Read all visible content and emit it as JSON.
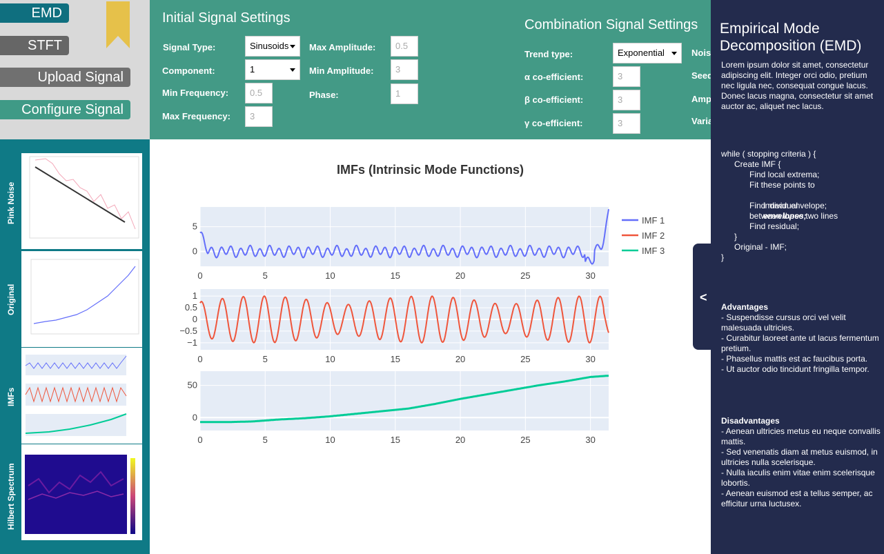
{
  "nav": {
    "emd": "EMD",
    "stft": "STFT",
    "upload": "Upload Signal",
    "configure": "Configure Signal"
  },
  "initial": {
    "title": "Initial Signal Settings",
    "signal_type_label": "Signal Type:",
    "signal_type_value": "Sinusoids",
    "component_label": "Component:",
    "component_value": "1",
    "min_freq_label": "Min Frequency:",
    "min_freq_value": "0.5",
    "max_freq_label": "Max Frequency:",
    "max_freq_value": "3",
    "max_amp_label": "Max Amplitude:",
    "max_amp_value": "0.5",
    "min_amp_label": "Min Amplitude:",
    "min_amp_value": "3",
    "phase_label": "Phase:",
    "phase_value": "1"
  },
  "combination": {
    "title": "Combination Signal Settings",
    "trend_label": "Trend type:",
    "trend_value": "Exponential",
    "alpha_label": "α co-efficient:",
    "alpha_value": "3",
    "beta_label": "β co-efficient:",
    "beta_value": "3",
    "gamma_label": "γ co-efficient:",
    "gamma_value": "3",
    "noise_label": "Nois",
    "seed_label": "Seed",
    "amp_label": "Amp",
    "var_label": "Varia"
  },
  "thumbnails": [
    {
      "label": "Pink Noise"
    },
    {
      "label": "Original"
    },
    {
      "label": "IMFs"
    },
    {
      "label": "Hilbert Spectrum"
    }
  ],
  "chart_data": {
    "type": "line",
    "title": "IMFs (Intrinsic Mode Functions)",
    "xlim": [
      0,
      31.4
    ],
    "xticks": [
      0,
      5,
      10,
      15,
      20,
      25,
      30
    ],
    "subplots": [
      {
        "name": "IMF 1",
        "color": "#636efa",
        "ylim": [
          -3,
          9
        ],
        "yticks": [
          5,
          0
        ],
        "ytick_labels": [
          "5",
          "0"
        ]
      },
      {
        "name": "IMF 2",
        "color": "#ef553b",
        "ylim": [
          -1.3,
          1.3
        ],
        "yticks": [
          1,
          0.5,
          0,
          -0.5,
          -1
        ],
        "ytick_labels": [
          "1",
          "0.5",
          "0",
          "−0.5",
          "−1"
        ]
      },
      {
        "name": "IMF 3",
        "color": "#00cc96",
        "ylim": [
          -20,
          72
        ],
        "yticks": [
          50,
          0
        ],
        "ytick_labels": [
          "50",
          "0"
        ]
      }
    ],
    "legend": [
      "IMF 1",
      "IMF 2",
      "IMF 3"
    ],
    "legend_position": "top-right",
    "imf3_points": {
      "x": [
        0,
        2,
        4,
        6,
        8,
        10,
        12,
        14,
        16,
        18,
        20,
        22,
        24,
        26,
        28,
        30,
        31.4
      ],
      "y": [
        -7,
        -7,
        -6,
        -3,
        -1,
        2,
        6,
        10,
        14,
        21,
        29,
        36,
        43,
        50,
        56,
        63,
        65
      ]
    }
  },
  "panel": {
    "title": "Empirical Mode Decomposition (EMD)",
    "intro": "Lorem ipsum dolor sit amet, consectetur adipiscing elit. Integer orci odio, pretium nec ligula nec, consequat congue lacus. Donec lacus magna, consectetur sit amet auctor ac, aliquet nec lacus.",
    "algo_1": "while ( stopping criteria ) {",
    "algo_2": "Create IMF {",
    "algo_3": "Find local extrema;",
    "algo_4": "Fit these points to",
    "algo_5": "individual",
    "algo_5b": "envelopes;",
    "algo_6": "Find mean envelope;",
    "algo_7": "between these two lines",
    "algo_8": "Find residual;",
    "algo_9": "}",
    "algo_10": "Original - IMF;",
    "algo_11": "}",
    "adv_title": "Advantages",
    "adv_text": "- Suspendisse cursus orci vel velit malesuada ultricies.\n- Curabitur laoreet ante ut lacus fermentum pretium.\n- Phasellus mattis est ac faucibus porta.\n- Ut auctor odio tincidunt fringilla tempor.",
    "dis_title": "Disadvantages",
    "dis_text": "- Aenean ultricies metus eu neque convallis mattis.\n- Sed venenatis diam at metus euismod, in ultricies nulla scelerisque.\n- Nulla iaculis enim vitae enim scelerisque lobortis.\n- Aenean euismod est a tellus semper, ac efficitur urna luctusex.",
    "collapse_icon": "chevron-left-icon"
  }
}
